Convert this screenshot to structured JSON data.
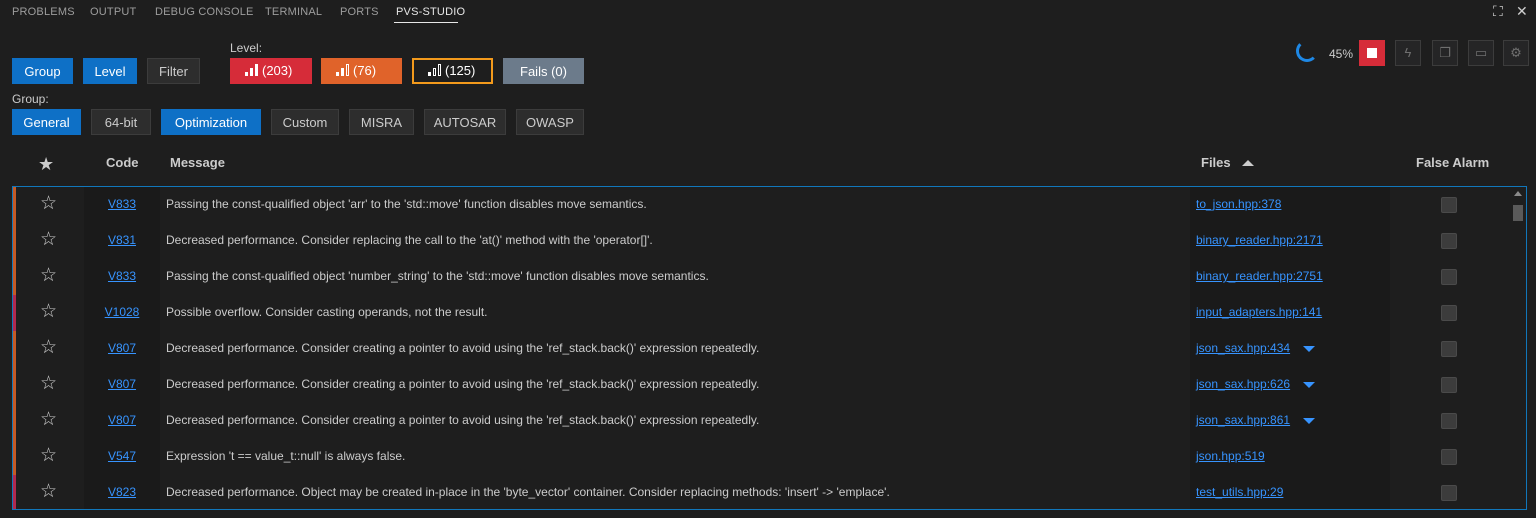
{
  "panel_tabs": [
    "PROBLEMS",
    "OUTPUT",
    "DEBUG CONSOLE",
    "TERMINAL",
    "PORTS",
    "PVS-STUDIO"
  ],
  "toolbar": {
    "group": "Group",
    "level": "Level",
    "filter": "Filter",
    "level_label": "Level:",
    "group_label": "Group:"
  },
  "levels": {
    "high": "(203)",
    "medium": "(76)",
    "low": "(125)",
    "fails": "Fails (0)"
  },
  "groups": [
    "General",
    "64-bit",
    "Optimization",
    "Custom",
    "MISRA",
    "AUTOSAR",
    "OWASP"
  ],
  "progress": {
    "value": 45,
    "text": "45%"
  },
  "columns": {
    "code": "Code",
    "message": "Message",
    "files": "Files",
    "false_alarm": "False Alarm"
  },
  "colors": {
    "accent": "#0e70c6",
    "high": "#d62c39",
    "medium": "#e0632a",
    "low": "#f39a1c",
    "fails": "#6c7b8b",
    "link": "#3794ff"
  },
  "rows": [
    {
      "code": "V833",
      "message": "Passing the const-qualified object 'arr' to the 'std::move' function disables move semantics.",
      "file": "to_json.hpp:378",
      "severity": "medium",
      "more": false
    },
    {
      "code": "V831",
      "message": "Decreased performance. Consider replacing the call to the 'at()' method with the 'operator[]'.",
      "file": "binary_reader.hpp:2171",
      "severity": "medium",
      "more": false
    },
    {
      "code": "V833",
      "message": "Passing the const-qualified object 'number_string' to the 'std::move' function disables move semantics.",
      "file": "binary_reader.hpp:2751",
      "severity": "medium",
      "more": false
    },
    {
      "code": "V1028",
      "message": "Possible overflow. Consider casting operands, not the result.",
      "file": "input_adapters.hpp:141",
      "severity": "high",
      "more": false
    },
    {
      "code": "V807",
      "message": "Decreased performance. Consider creating a pointer to avoid using the 'ref_stack.back()' expression repeatedly.",
      "file": "json_sax.hpp:434",
      "severity": "medium",
      "more": true
    },
    {
      "code": "V807",
      "message": "Decreased performance. Consider creating a pointer to avoid using the 'ref_stack.back()' expression repeatedly.",
      "file": "json_sax.hpp:626",
      "severity": "medium",
      "more": true
    },
    {
      "code": "V807",
      "message": "Decreased performance. Consider creating a pointer to avoid using the 'ref_stack.back()' expression repeatedly.",
      "file": "json_sax.hpp:861",
      "severity": "medium",
      "more": true
    },
    {
      "code": "V547",
      "message": "Expression 't == value_t::null' is always false.",
      "file": "json.hpp:519",
      "severity": "medium",
      "more": false
    },
    {
      "code": "V823",
      "message": "Decreased performance. Object may be created in-place in the 'byte_vector' container. Consider replacing methods: 'insert' -> 'emplace'.",
      "file": "test_utils.hpp:29",
      "severity": "high",
      "more": false
    }
  ]
}
